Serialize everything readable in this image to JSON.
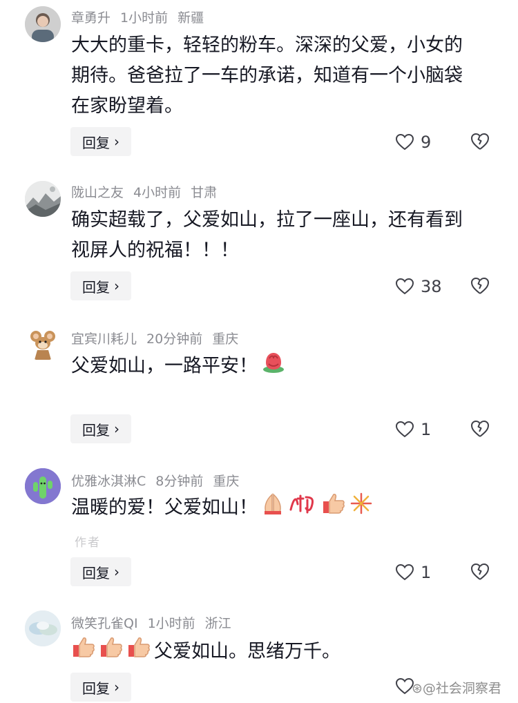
{
  "comments": [
    {
      "username": "章勇升",
      "time": "1小时前",
      "location": "新疆",
      "lines": [
        "大大的重卡，轻轻的粉车。深深的父爱，小女的",
        "期待。爸爸拉了一车的承诺，知道有一个小脑袋",
        "在家盼望着。"
      ],
      "reply_label": "回复",
      "likes": "9",
      "avatar_icon": "person-photo-avatar"
    },
    {
      "username": "陇山之友",
      "time": "4小时前",
      "location": "甘肃",
      "lines": [
        "确实超载了，父爱如山，拉了一座山，还有看到",
        "视屏人的祝福！！！"
      ],
      "reply_label": "回复",
      "likes": "38",
      "avatar_icon": "landscape-painting-avatar"
    },
    {
      "username": "宜宾川耗儿",
      "time": "20分钟前",
      "location": "重庆",
      "lines": [
        "父爱如山，一路平安！"
      ],
      "emojis": [
        "rose-emoji"
      ],
      "reply_label": "回复",
      "likes": "1",
      "avatar_icon": "cartoon-mouse-avatar"
    },
    {
      "username": "优雅冰淇淋C",
      "time": "8分钟前",
      "location": "重庆",
      "lines": [
        "温暖的爱！父爱如山！"
      ],
      "emojis": [
        "pray-emoji",
        "geili-emoji",
        "thumbs-up-emoji",
        "fireworks-emoji"
      ],
      "author_tag": "作者",
      "reply_label": "回复",
      "likes": "1",
      "avatar_icon": "green-cactus-avatar"
    },
    {
      "username": "微笑孔雀QI",
      "time": "1小时前",
      "location": "浙江",
      "lines": [
        "父爱如山。思绪万千。"
      ],
      "emojis": [
        "thumbs-up-emoji",
        "thumbs-up-emoji",
        "thumbs-up-emoji"
      ],
      "reply_label": "回复",
      "avatar_icon": "cloud-avatar"
    }
  ],
  "watermark": "⊛@社会洞察君",
  "colors": {
    "meta": "#8a8b91",
    "text": "#161823",
    "reply_bg": "#f3f3f4",
    "icon": "#3f4048"
  }
}
